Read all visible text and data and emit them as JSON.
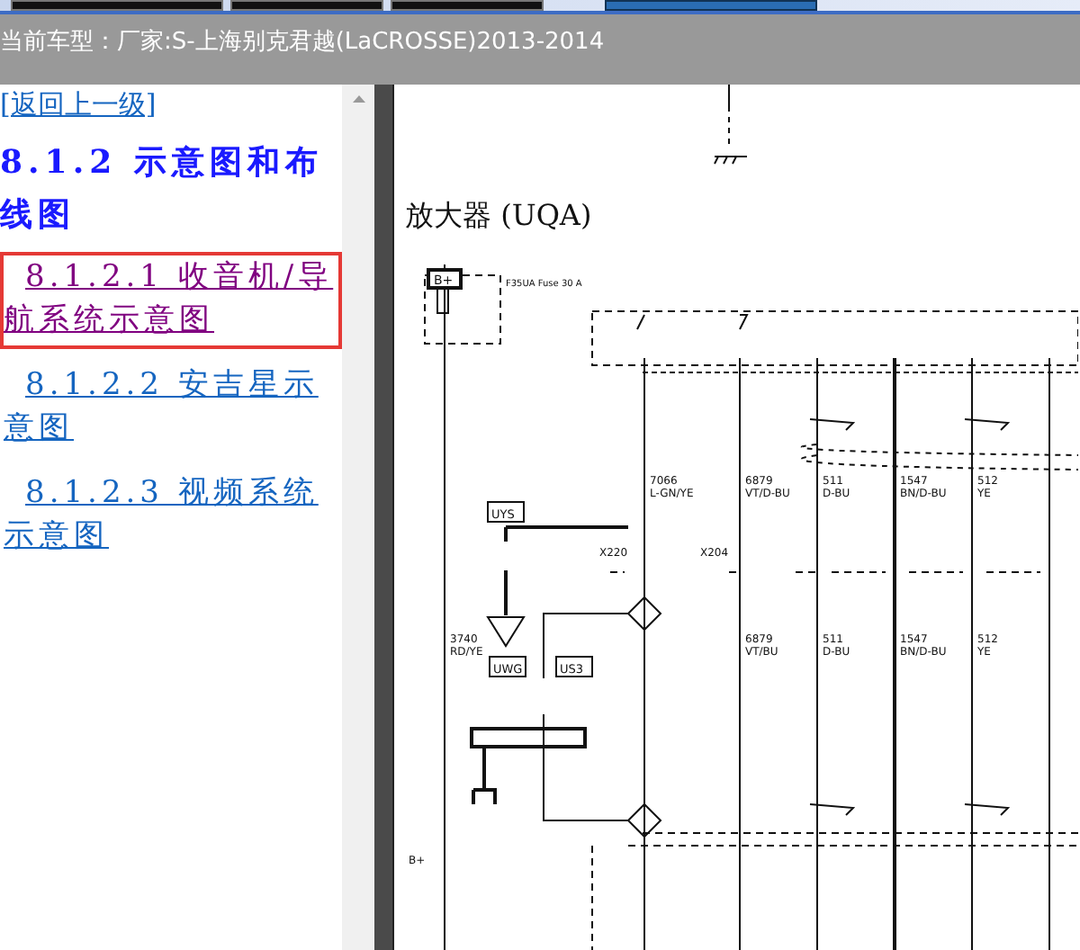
{
  "header": {
    "title": "当前车型：厂家:S-上海别克君越(LaCROSSE)2013-2014"
  },
  "sidebar": {
    "back_link": "[返回上一级]",
    "heading": "8.1.2 示意图和布线图",
    "items": [
      {
        "label": "8.1.2.1 收音机/导航系统示意图",
        "selected": true
      },
      {
        "label": "8.1.2.2 安吉星示意图",
        "selected": false
      },
      {
        "label": "8.1.2.3 视频系统示意图",
        "selected": false
      }
    ]
  },
  "diagram": {
    "title": "放大器 (UQA)",
    "power_label": "B+",
    "fuse_label": "F35UA Fuse 30 A",
    "bottom_power_label": "B+",
    "connectors": [
      "X220",
      "X204"
    ],
    "modules": [
      "UYS",
      "UWG",
      "US3"
    ],
    "upper_wires": [
      {
        "code": "7066",
        "color_code": "L-GN/YE"
      },
      {
        "code": "6879",
        "color_code": "VT/D-BU"
      },
      {
        "code": "511",
        "color_code": "D-BU"
      },
      {
        "code": "1547",
        "color_code": "BN/D-BU"
      },
      {
        "code": "512",
        "color_code": "YE"
      }
    ],
    "lower_wires": [
      {
        "code": "3740",
        "color_code": "RD/YE"
      },
      {
        "code": "6879",
        "color_code": "VT/BU"
      },
      {
        "code": "511",
        "color_code": "D-BU"
      },
      {
        "code": "1547",
        "color_code": "BN/D-BU"
      },
      {
        "code": "512",
        "color_code": "YE"
      }
    ]
  }
}
